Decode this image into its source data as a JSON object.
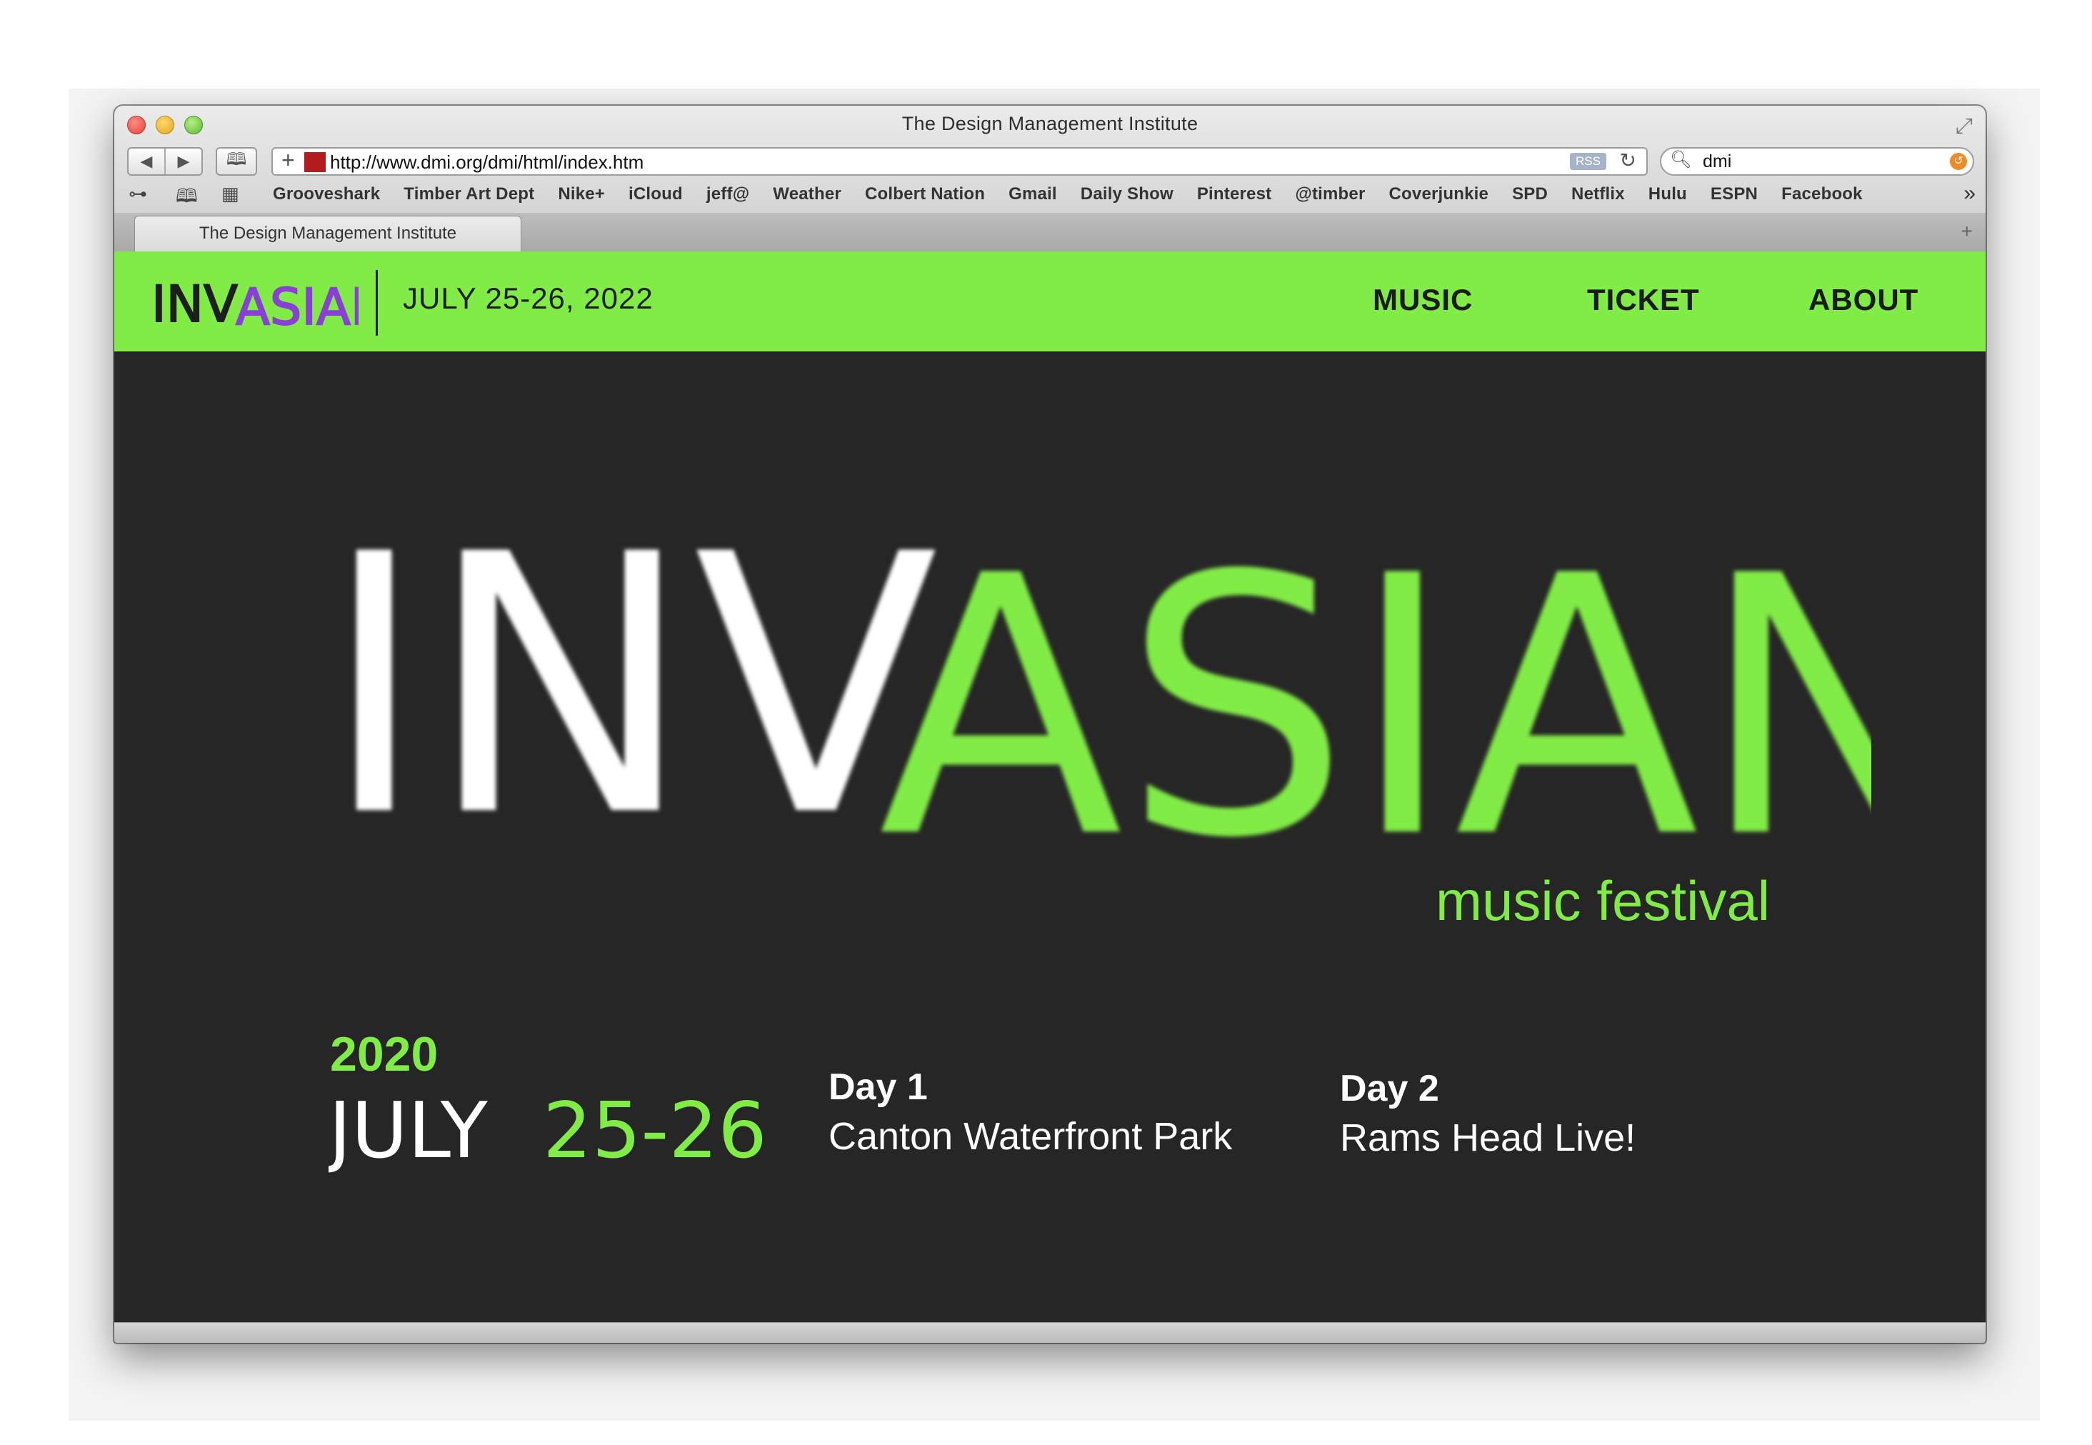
{
  "browser": {
    "window_title": "The Design Management Institute",
    "url": "http://www.dmi.org/dmi/html/index.htm",
    "rss_label": "RSS",
    "search_value": "dmi",
    "bookmarks": [
      "Grooveshark",
      "Timber Art Dept",
      "Nike+",
      "iCloud",
      "jeff@",
      "Weather",
      "Colbert Nation",
      "Gmail",
      "Daily Show",
      "Pinterest",
      "@timber",
      "Coverjunkie",
      "SPD",
      "Netflix",
      "Hulu",
      "ESPN",
      "Facebook"
    ],
    "tab_title": "The Design Management Institute"
  },
  "site": {
    "logo_text_white": "INV",
    "logo_text_accent": "ASIAN",
    "header_date": "JULY 25-26, 2022",
    "nav": {
      "music": "MUSIC",
      "ticket": "TICKET",
      "about": "ABOUT"
    },
    "hero_white": "INV",
    "hero_green": "ASIAN",
    "hero_subtitle": "music festival",
    "year": "2020",
    "month": "JULY",
    "days_range": "25-26",
    "days": [
      {
        "label": "Day 1",
        "venue": "Canton Waterfront Park"
      },
      {
        "label": "Day 2",
        "venue": "Rams Head Live!"
      }
    ]
  },
  "colors": {
    "accent_green": "#82ec47",
    "background_dark": "#262626",
    "logo_purple": "#8a3fd6"
  }
}
